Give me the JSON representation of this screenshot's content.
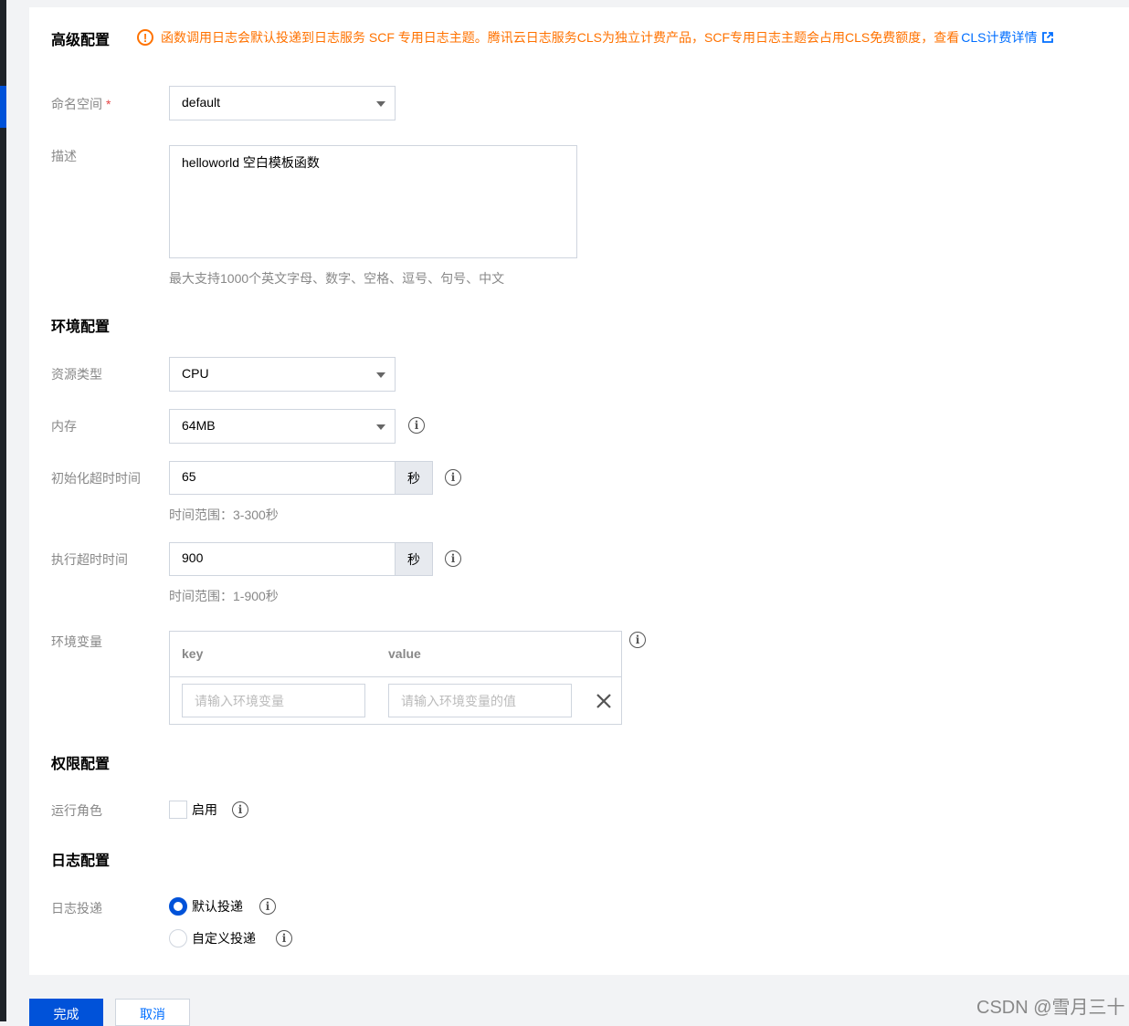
{
  "advanced": {
    "title": "高级配置",
    "notice": "函数调用日志会默认投递到日志服务 SCF 专用日志主题。腾讯云日志服务CLS为独立计费产品，SCF专用日志主题会占用CLS免费额度，查看",
    "notice_link": "CLS计费详情",
    "namespace_label": "命名空间",
    "required_mark": "*",
    "namespace_value": "default",
    "desc_label": "描述",
    "desc_value": "helloworld 空白模板函数",
    "desc_hint": "最大支持1000个英文字母、数字、空格、逗号、句号、中文"
  },
  "env": {
    "title": "环境配置",
    "resource_label": "资源类型",
    "resource_value": "CPU",
    "memory_label": "内存",
    "memory_value": "64MB",
    "init_timeout_label": "初始化超时时间",
    "init_timeout_value": "65",
    "init_timeout_unit": "秒",
    "init_timeout_hint": "时间范围：3-300秒",
    "exec_timeout_label": "执行超时时间",
    "exec_timeout_value": "900",
    "exec_timeout_unit": "秒",
    "exec_timeout_hint": "时间范围：1-900秒",
    "vars_label": "环境变量",
    "vars_key_header": "key",
    "vars_value_header": "value",
    "vars_key_placeholder": "请输入环境变量",
    "vars_value_placeholder": "请输入环境变量的值"
  },
  "permission": {
    "title": "权限配置",
    "role_label": "运行角色",
    "enable_label": "启用"
  },
  "log": {
    "title": "日志配置",
    "delivery_label": "日志投递",
    "option_default": "默认投递",
    "option_custom": "自定义投递"
  },
  "footer": {
    "submit_label": "完成",
    "cancel_label": "取消"
  },
  "watermark": "CSDN @雪月三十",
  "colors": {
    "primary": "#0052d9",
    "warning": "#ff7200",
    "link": "#006eff"
  }
}
